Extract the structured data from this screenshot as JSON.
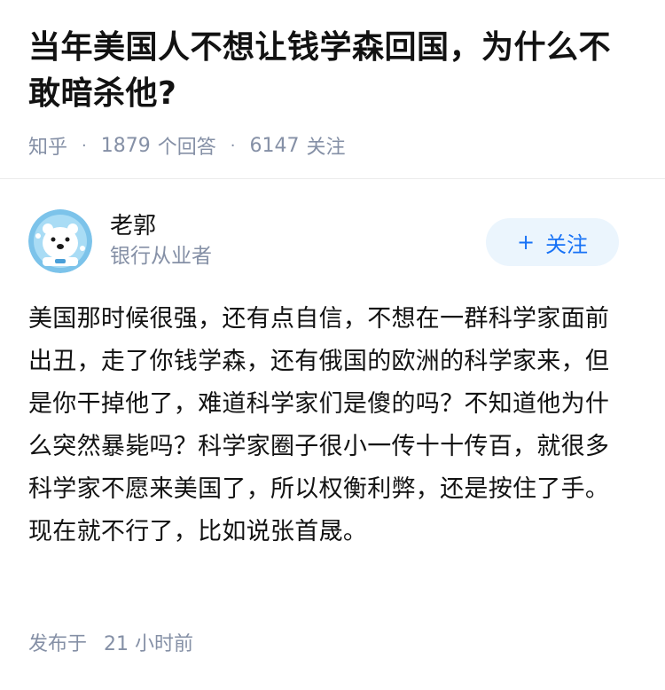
{
  "question": {
    "title": "当年美国人不想让钱学森回国，为什么不敢暗杀他?",
    "source": "知乎",
    "answer_count": "1879",
    "answer_label": "个回答",
    "follower_count": "6147",
    "follower_label": "关注"
  },
  "author": {
    "name": "老郭",
    "description": "银行从业者",
    "avatar_icon": "polar-bear-astronaut-avatar",
    "follow_label": "关注",
    "follow_icon": "plus-icon"
  },
  "answer": {
    "text": "美国那时候很强，还有点自信，不想在一群科学家面前出丑，走了你钱学森，还有俄国的欧洲的科学家来，但是你干掉他了，难道科学家们是傻的吗？不知道他为什么突然暴毙吗？科学家圈子很小一传十十传百，就很多科学家不愿来美国了，所以权衡利弊，还是按住了手。现在就不行了，比如说张首晟。",
    "published_label": "发布于",
    "published_time": "21 小时前"
  },
  "colors": {
    "text": "#121212",
    "meta": "#8590a6",
    "brand_blue": "#1772f6",
    "button_bg": "#ebf5fd"
  }
}
